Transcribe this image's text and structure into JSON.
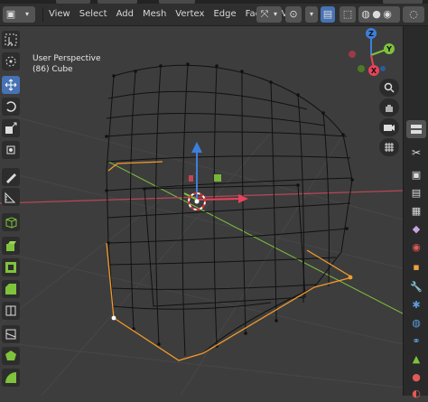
{
  "header": {
    "menus": [
      "View",
      "Select",
      "Add",
      "Mesh",
      "Vertex",
      "Edge",
      "Face",
      "UV"
    ]
  },
  "viewport": {
    "perspective": "User Perspective",
    "object": "(86) Cube"
  },
  "gizmo": {
    "z": "Z",
    "y": "Y",
    "x": "X"
  },
  "colors": {
    "x_axis": "#e8435a",
    "y_axis": "#7fc23c",
    "z_axis": "#3d7fde",
    "selection": "#f39a2b",
    "active_tool": "#4772b3"
  },
  "icons": {
    "toolbar": [
      "select-box-icon",
      "cursor-icon",
      "move-icon",
      "rotate-icon",
      "scale-icon",
      "transform-icon",
      "annotate-icon",
      "measure-icon",
      "add-cube-icon",
      "extrude-icon",
      "inset-icon",
      "bevel-icon",
      "loop-cut-icon",
      "knife-icon",
      "poly-build-icon",
      "spin-icon",
      "smooth-icon",
      "shear-icon"
    ],
    "nav": [
      "zoom-icon",
      "hand-icon",
      "camera-icon",
      "grid-icon"
    ],
    "properties": [
      "tool-icon",
      "render-icon",
      "output-icon",
      "view-layer-icon",
      "scene-icon",
      "world-icon",
      "object-icon",
      "modifier-icon",
      "particles-icon",
      "physics-icon",
      "constraints-icon",
      "data-icon",
      "material-icon",
      "texture-icon"
    ]
  }
}
